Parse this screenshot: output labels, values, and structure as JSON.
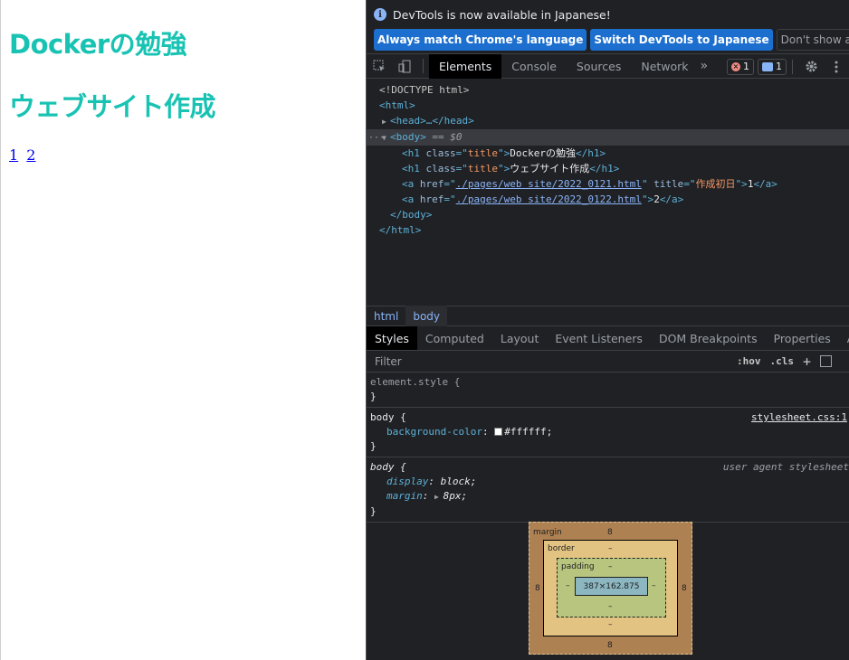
{
  "page": {
    "title1": "Dockerの勉強",
    "title2": "ウェブサイト作成",
    "link1": "1",
    "link2": "2"
  },
  "devtools": {
    "infobar": {
      "message": "DevTools is now available in Japanese!",
      "btn_match": "Always match Chrome's language",
      "btn_switch": "Switch DevTools to Japanese",
      "btn_dismiss": "Don't show again"
    },
    "tabs": [
      "Elements",
      "Console",
      "Sources",
      "Network"
    ],
    "more": "»",
    "error_count": "1",
    "message_count": "1",
    "dom": {
      "doctype": "<!DOCTYPE html>",
      "html_open": "<html>",
      "head": "<head>…</head>",
      "body_open": "<body>",
      "body_eq": " == $0",
      "h1_1_text": "Dockerの勉強",
      "h1_2_text": "ウェブサイト作成",
      "a1_href": "./pages/web site/2022_0121.html",
      "a1_title": "作成初日",
      "a1_text": "1",
      "a2_href": "./pages/web site/2022_0122.html",
      "a2_text": "2",
      "body_close": "</body>",
      "html_close": "</html>"
    },
    "breadcrumbs": [
      "html",
      "body"
    ],
    "subtabs": [
      "Styles",
      "Computed",
      "Layout",
      "Event Listeners",
      "DOM Breakpoints",
      "Properties",
      "Accessibility"
    ],
    "filter_placeholder": "Filter",
    "hov": ":hov",
    "cls": ".cls",
    "rules": {
      "element_style": "element.style {",
      "body1_selector": "body {",
      "body1_source": "stylesheet.css:1",
      "body1_prop": "background-color",
      "body1_value": "#ffffff;",
      "body2_selector": "body {",
      "body2_source": "user agent stylesheet",
      "body2_prop1": "display",
      "body2_val1": "block;",
      "body2_prop2": "margin",
      "body2_val2": "8px;",
      "close": "}"
    },
    "boxmodel": {
      "margin_label": "margin",
      "margin_value": "8",
      "border_label": "border",
      "border_value": "–",
      "padding_label": "padding",
      "padding_value": "–",
      "content": "387×162.875"
    }
  }
}
